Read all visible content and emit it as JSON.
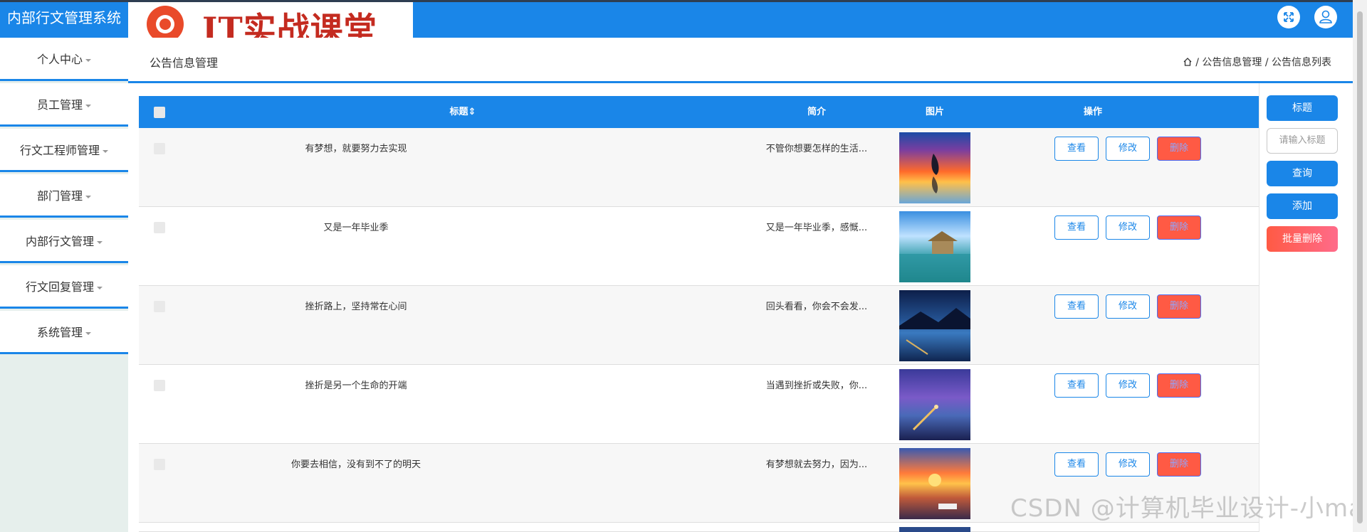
{
  "header": {
    "app_title": "内部行文管理系统",
    "logo_text": "IT实战课堂",
    "fullscreen_icon": "fullscreen-icon",
    "user_icon": "user-icon"
  },
  "sidebar": {
    "items": [
      {
        "label": "个人中心"
      },
      {
        "label": "员工管理"
      },
      {
        "label": "行文工程师管理"
      },
      {
        "label": "部门管理"
      },
      {
        "label": "内部行文管理"
      },
      {
        "label": "行文回复管理"
      },
      {
        "label": "系统管理"
      }
    ]
  },
  "breadcrumb": {
    "page_title": "公告信息管理",
    "home_icon": "home-icon",
    "path": "/ 公告信息管理 / 公告信息列表"
  },
  "table": {
    "columns": [
      "标题",
      "简介",
      "图片",
      "操作"
    ],
    "sort_icon": "sort-icon",
    "rows": [
      {
        "title": "有梦想，就要努力去实现",
        "intro": "不管你想要怎样的生活...",
        "image": "sunset-dolphin"
      },
      {
        "title": "又是一年毕业季",
        "intro": "又是一年毕业季，感慨...",
        "image": "tropical-lagoon"
      },
      {
        "title": "挫折路上，坚持常在心间",
        "intro": "回头看看，你会不会发...",
        "image": "mountain-lake-night"
      },
      {
        "title": "挫折是另一个生命的开端",
        "intro": "当遇到挫折或失败，你...",
        "image": "purple-pier"
      },
      {
        "title": "你要去相信，没有到不了的明天",
        "intro": "有梦想就去努力，因为...",
        "image": "sunset-harbor"
      }
    ],
    "actions": {
      "view": "查看",
      "edit": "修改",
      "delete": "删除"
    }
  },
  "search_panel": {
    "title_button": "标题",
    "title_placeholder": "请输入标题",
    "query_button": "查询",
    "add_button": "添加",
    "batch_delete_button": "批量删除"
  },
  "watermark": "CSDN @计算机毕业设计-小ma",
  "colors": {
    "primary": "#1a86e8",
    "danger": "#ff5a44",
    "sidebar_bg": "#e6efec"
  }
}
